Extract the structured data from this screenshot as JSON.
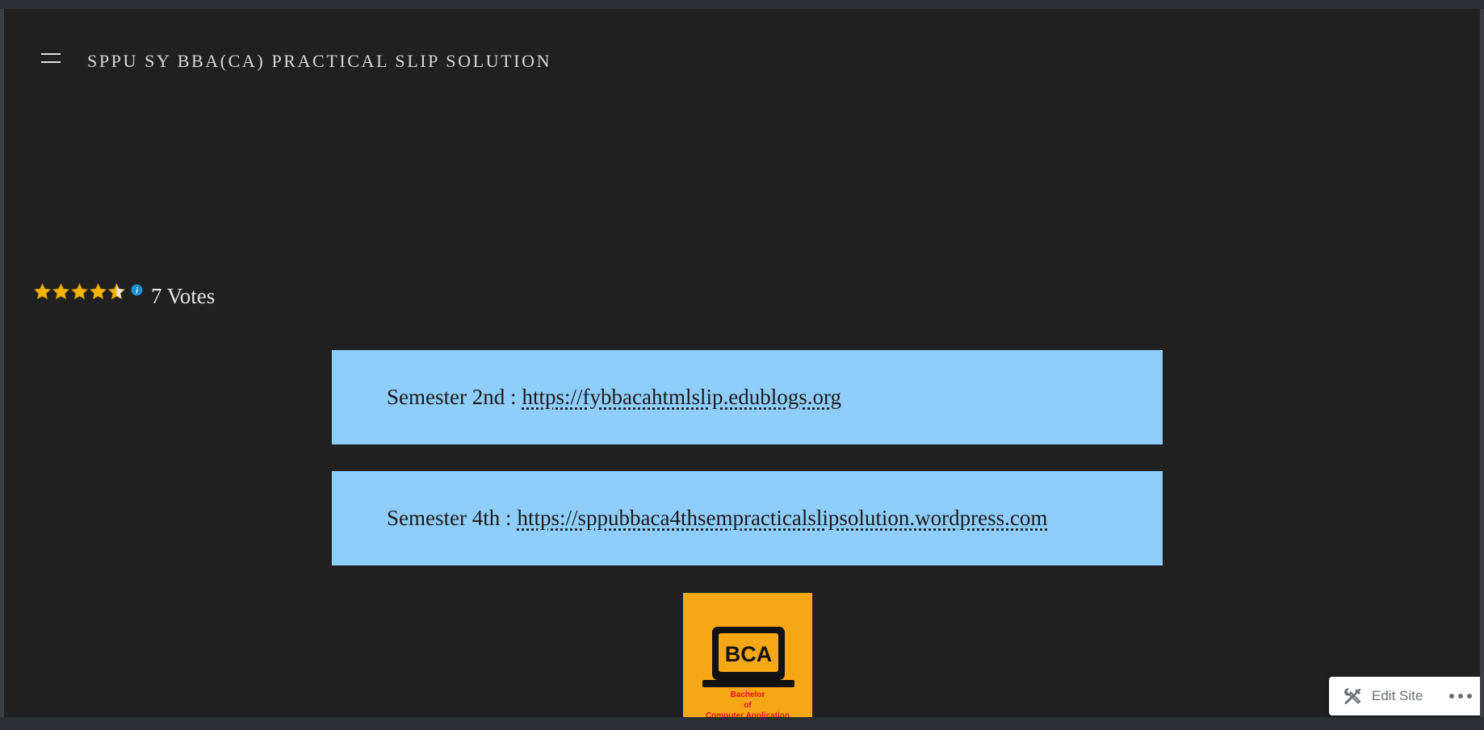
{
  "header": {
    "site_title": "SPPU SY BBA(CA) PRACTICAL SLIP SOLUTION",
    "menu_icon": "hamburger-menu-icon"
  },
  "rating": {
    "stars_filled": 4.5,
    "stars_total": 5,
    "votes_label": "7 Votes",
    "info_icon": "info-icon",
    "star_color": "#f5b400"
  },
  "semesters": [
    {
      "label": "Semester 2nd :",
      "url": "https://fybbacahtmlslip.edublogs.org"
    },
    {
      "label": "Semester 4th :",
      "url": "https://sppubbaca4thsempracticalslipsolution.wordpress.com"
    }
  ],
  "logo": {
    "badge": "BCA",
    "caption": [
      "Bachelor",
      "of",
      "Computer Application"
    ],
    "background": "#f5a716",
    "caption_color": "#e0141e"
  },
  "admin_bar": {
    "edit_label": "Edit Site",
    "edit_icon": "tools-icon",
    "more_icon": "more-horizontal-icon"
  },
  "colors": {
    "page_background": "#202020",
    "box_background": "#8fcefa",
    "title_text": "#d8d8d8"
  }
}
